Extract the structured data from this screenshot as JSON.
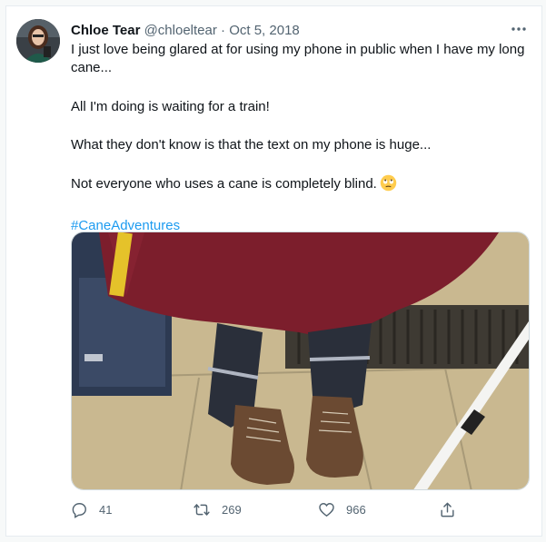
{
  "tweet": {
    "author_name": "Chloe Tear",
    "handle": "@chloeltear",
    "separator": "·",
    "date": "Oct 5, 2018",
    "paragraphs": [
      "I just love being glared at for using my phone in public when I have my long cane...",
      "All I'm doing is waiting for a train!",
      "What they don't know is that the text on my phone is huge...",
      "Not everyone who uses a cane is completely blind."
    ],
    "emoji_icon": "rolling-eyes-emoji-icon",
    "hashtag": "#CaneAdventures"
  },
  "actions": {
    "replies": "41",
    "retweets": "269",
    "likes": "966"
  },
  "icons": {
    "reply": "reply-icon",
    "retweet": "retweet-icon",
    "like": "heart-icon",
    "share": "share-icon",
    "more": "more-icon"
  },
  "colors": {
    "accent": "#1d9bf0",
    "text": "#0f1419",
    "muted": "#536471"
  }
}
